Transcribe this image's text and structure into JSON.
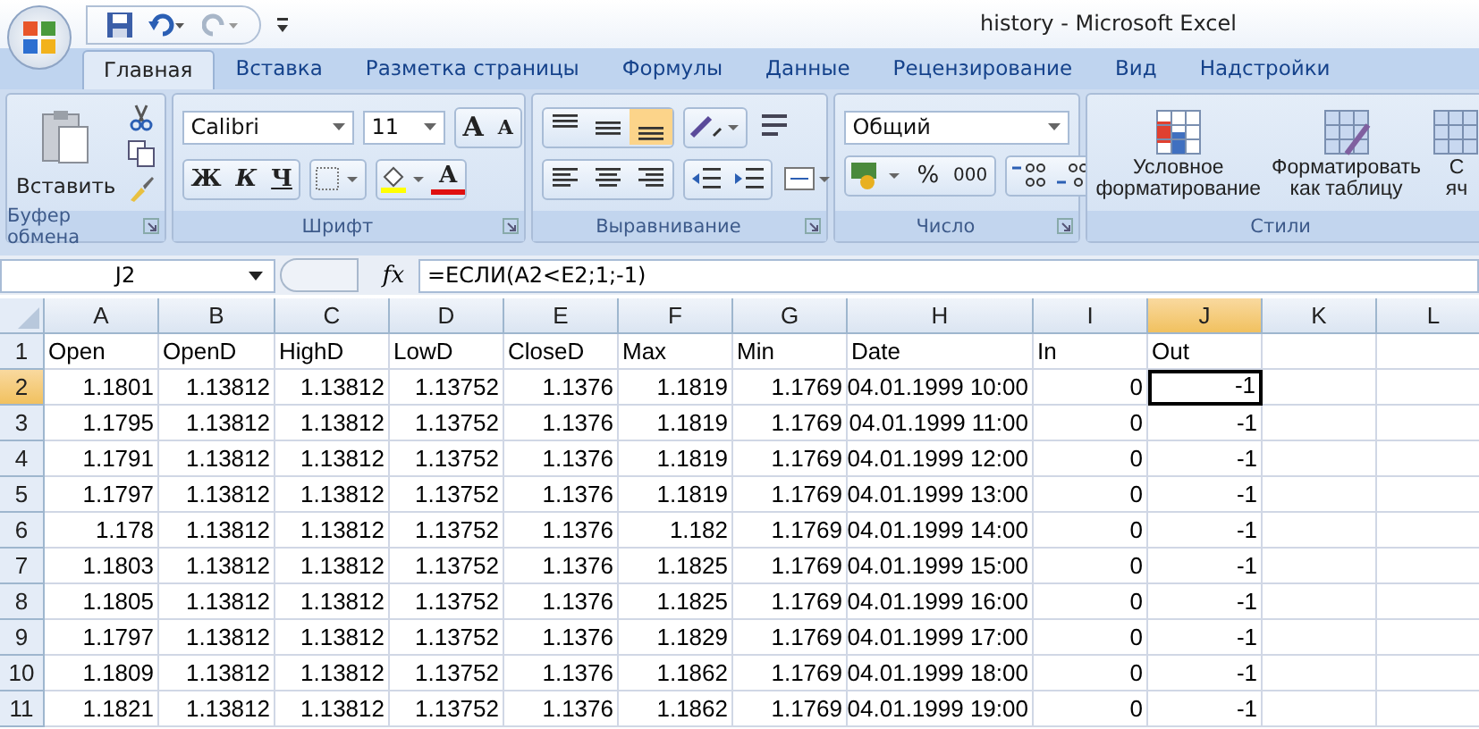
{
  "window": {
    "title": "history - Microsoft Excel"
  },
  "tabs": [
    {
      "label": "Главная",
      "selected": true
    },
    {
      "label": "Вставка",
      "selected": false
    },
    {
      "label": "Разметка страницы",
      "selected": false
    },
    {
      "label": "Формулы",
      "selected": false
    },
    {
      "label": "Данные",
      "selected": false
    },
    {
      "label": "Рецензирование",
      "selected": false
    },
    {
      "label": "Вид",
      "selected": false
    },
    {
      "label": "Надстройки",
      "selected": false
    }
  ],
  "ribbon": {
    "clipboard": {
      "label": "Буфер обмена",
      "paste": "Вставить"
    },
    "font": {
      "label": "Шрифт",
      "font_name": "Calibri",
      "font_size": "11",
      "grow": "A",
      "shrink": "A",
      "bold": "Ж",
      "italic": "К",
      "underline": "Ч",
      "font_color": "A"
    },
    "alignment": {
      "label": "Выравнивание",
      "bottom_align_selected": true
    },
    "number": {
      "label": "Число",
      "format": "Общий",
      "percent": "%",
      "thousands": "000"
    },
    "styles": {
      "label": "Стили",
      "buttons": [
        {
          "line1": "Условное",
          "line2": "форматирование"
        },
        {
          "line1": "Форматировать",
          "line2": "как таблицу"
        },
        {
          "line1": "С",
          "line2": "яч"
        }
      ]
    }
  },
  "formula_bar": {
    "name_box": "J2",
    "fx": "fx",
    "formula": "=ЕСЛИ(A2<E2;1;-1)"
  },
  "sheet": {
    "columns": [
      {
        "label": "A",
        "selected": false
      },
      {
        "label": "B",
        "selected": false
      },
      {
        "label": "C",
        "selected": false
      },
      {
        "label": "D",
        "selected": false
      },
      {
        "label": "E",
        "selected": false
      },
      {
        "label": "F",
        "selected": false
      },
      {
        "label": "G",
        "selected": false
      },
      {
        "label": "H",
        "selected": false
      },
      {
        "label": "I",
        "selected": false
      },
      {
        "label": "J",
        "selected": true
      },
      {
        "label": "K",
        "selected": false
      },
      {
        "label": "L",
        "selected": false
      }
    ],
    "rows": [
      {
        "number": "1",
        "selected": false,
        "kind": "text",
        "cells": [
          "Open",
          "OpenD",
          "HighD",
          "LowD",
          "CloseD",
          "Max",
          "Min",
          "Date",
          "In",
          "Out"
        ]
      },
      {
        "number": "2",
        "selected": true,
        "kind": "number",
        "cells": [
          "1.1801",
          "1.13812",
          "1.13812",
          "1.13752",
          "1.1376",
          "1.1819",
          "1.1769",
          "04.01.1999 10:00",
          "0",
          "-1"
        ]
      },
      {
        "number": "3",
        "selected": false,
        "kind": "number",
        "cells": [
          "1.1795",
          "1.13812",
          "1.13812",
          "1.13752",
          "1.1376",
          "1.1819",
          "1.1769",
          "04.01.1999 11:00",
          "0",
          "-1"
        ]
      },
      {
        "number": "4",
        "selected": false,
        "kind": "number",
        "cells": [
          "1.1791",
          "1.13812",
          "1.13812",
          "1.13752",
          "1.1376",
          "1.1819",
          "1.1769",
          "04.01.1999 12:00",
          "0",
          "-1"
        ]
      },
      {
        "number": "5",
        "selected": false,
        "kind": "number",
        "cells": [
          "1.1797",
          "1.13812",
          "1.13812",
          "1.13752",
          "1.1376",
          "1.1819",
          "1.1769",
          "04.01.1999 13:00",
          "0",
          "-1"
        ]
      },
      {
        "number": "6",
        "selected": false,
        "kind": "number",
        "cells": [
          "1.178",
          "1.13812",
          "1.13812",
          "1.13752",
          "1.1376",
          "1.182",
          "1.1769",
          "04.01.1999 14:00",
          "0",
          "-1"
        ]
      },
      {
        "number": "7",
        "selected": false,
        "kind": "number",
        "cells": [
          "1.1803",
          "1.13812",
          "1.13812",
          "1.13752",
          "1.1376",
          "1.1825",
          "1.1769",
          "04.01.1999 15:00",
          "0",
          "-1"
        ]
      },
      {
        "number": "8",
        "selected": false,
        "kind": "number",
        "cells": [
          "1.1805",
          "1.13812",
          "1.13812",
          "1.13752",
          "1.1376",
          "1.1825",
          "1.1769",
          "04.01.1999 16:00",
          "0",
          "-1"
        ]
      },
      {
        "number": "9",
        "selected": false,
        "kind": "number",
        "cells": [
          "1.1797",
          "1.13812",
          "1.13812",
          "1.13752",
          "1.1376",
          "1.1829",
          "1.1769",
          "04.01.1999 17:00",
          "0",
          "-1"
        ]
      },
      {
        "number": "10",
        "selected": false,
        "kind": "number",
        "cells": [
          "1.1809",
          "1.13812",
          "1.13812",
          "1.13752",
          "1.1376",
          "1.1862",
          "1.1769",
          "04.01.1999 18:00",
          "0",
          "-1"
        ]
      },
      {
        "number": "11",
        "selected": false,
        "kind": "number",
        "cells": [
          "1.1821",
          "1.13812",
          "1.13812",
          "1.13752",
          "1.1376",
          "1.1862",
          "1.1769",
          "04.01.1999 19:00",
          "0",
          "-1"
        ]
      }
    ]
  }
}
